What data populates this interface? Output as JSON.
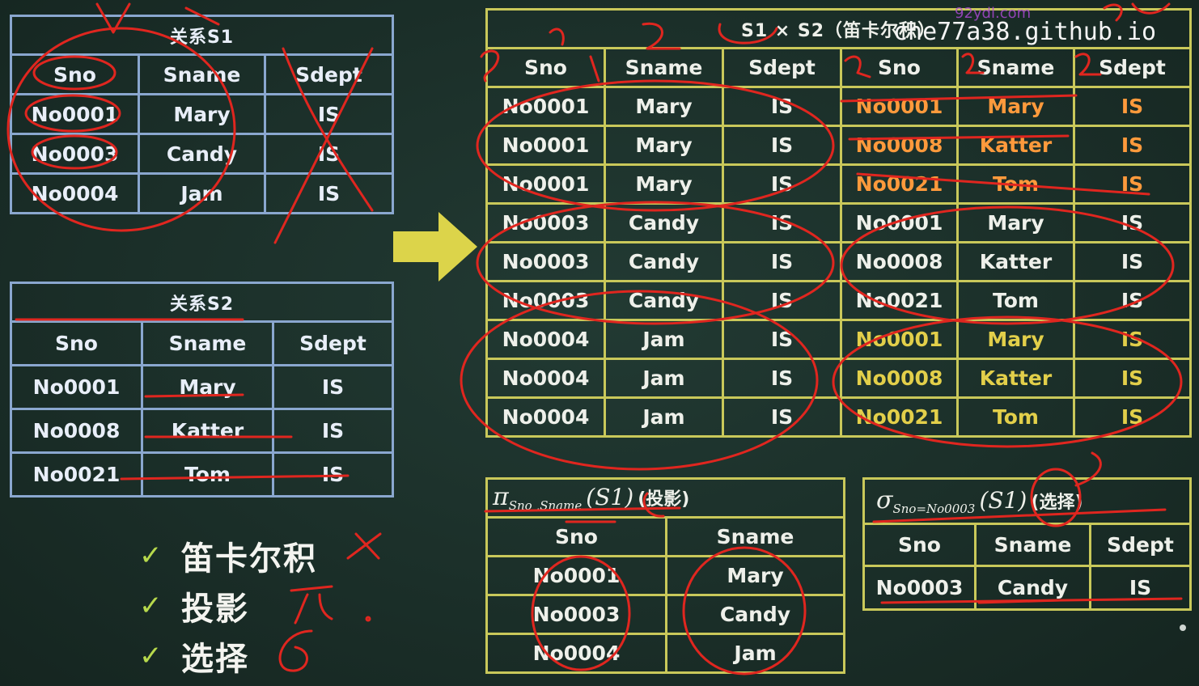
{
  "watermark": {
    "text": "che77a38.github.io",
    "small_text": "92ydl.com"
  },
  "s1": {
    "caption": "关系S1",
    "headers": [
      "Sno",
      "Sname",
      "Sdept"
    ],
    "rows": [
      [
        "No0001",
        "Mary",
        "IS"
      ],
      [
        "No0003",
        "Candy",
        "IS"
      ],
      [
        "No0004",
        "Jam",
        "IS"
      ]
    ]
  },
  "s2": {
    "caption": "关系S2",
    "headers": [
      "Sno",
      "Sname",
      "Sdept"
    ],
    "rows": [
      [
        "No0001",
        "Mary",
        "IS"
      ],
      [
        "No0008",
        "Katter",
        "IS"
      ],
      [
        "No0021",
        "Tom",
        "IS"
      ]
    ]
  },
  "product": {
    "caption": "S1 × S2（笛卡尔积）",
    "headers": [
      "Sno",
      "Sname",
      "Sdept",
      "Sno",
      "Sname",
      "Sdept"
    ],
    "rows": [
      [
        "No0001",
        "Mary",
        "IS",
        "No0001",
        "Mary",
        "IS"
      ],
      [
        "No0001",
        "Mary",
        "IS",
        "No0008",
        "Katter",
        "IS"
      ],
      [
        "No0001",
        "Mary",
        "IS",
        "No0021",
        "Tom",
        "IS"
      ],
      [
        "No0003",
        "Candy",
        "IS",
        "No0001",
        "Mary",
        "IS"
      ],
      [
        "No0003",
        "Candy",
        "IS",
        "No0008",
        "Katter",
        "IS"
      ],
      [
        "No0003",
        "Candy",
        "IS",
        "No0021",
        "Tom",
        "IS"
      ],
      [
        "No0004",
        "Jam",
        "IS",
        "No0001",
        "Mary",
        "IS"
      ],
      [
        "No0004",
        "Jam",
        "IS",
        "No0008",
        "Katter",
        "IS"
      ],
      [
        "No0004",
        "Jam",
        "IS",
        "No0021",
        "Tom",
        "IS"
      ]
    ]
  },
  "projection": {
    "symbol": "π",
    "subscript": "Sno ,Sname",
    "argument": "(S1)",
    "label": "(投影)",
    "headers": [
      "Sno",
      "Sname"
    ],
    "rows": [
      [
        "No0001",
        "Mary"
      ],
      [
        "No0003",
        "Candy"
      ],
      [
        "No0004",
        "Jam"
      ]
    ]
  },
  "selection": {
    "symbol": "σ",
    "subscript": "Sno=No0003",
    "argument": "(S1)",
    "label": "(选择)",
    "headers": [
      "Sno",
      "Sname",
      "Sdept"
    ],
    "rows": [
      [
        "No0003",
        "Candy",
        "IS"
      ]
    ]
  },
  "checklist": {
    "items": [
      {
        "icon": "✓",
        "label": "笛卡尔积"
      },
      {
        "icon": "✓",
        "label": "投影"
      },
      {
        "icon": "✓",
        "label": "选择"
      }
    ]
  },
  "colors": {
    "background": "#1b2f29",
    "blue_border": "#8aa7cf",
    "yellow_border": "#c9c85a",
    "orange_text": "#ff9a3c",
    "gold_text": "#e2cf4a",
    "check": "#b7d94c",
    "annotation": "#e0261f",
    "arrow": "#dcd44a"
  }
}
